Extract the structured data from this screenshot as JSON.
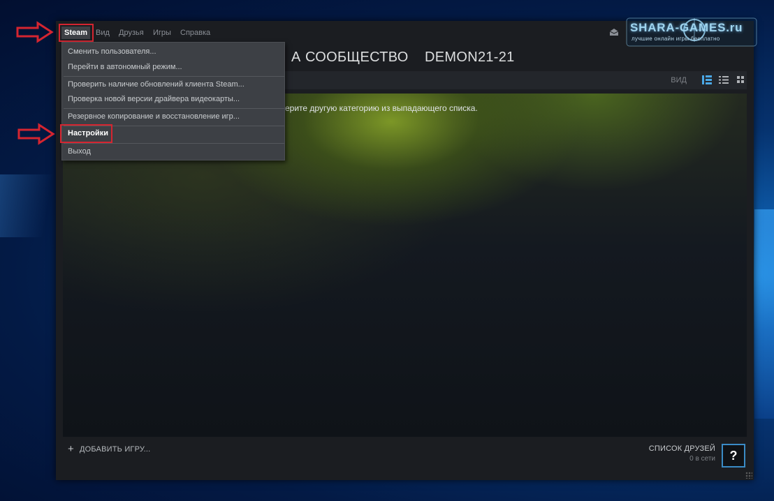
{
  "menubar": {
    "steam": "Steam",
    "view": "Вид",
    "friends": "Друзья",
    "games": "Игры",
    "help": "Справка"
  },
  "nav": {
    "partial_tab": "А",
    "community": "СООБЩЕСТВО",
    "username": "DEMON21-21"
  },
  "toolbar": {
    "view_label": "ВИД"
  },
  "dropdown": {
    "items": [
      "Сменить пользователя...",
      "Перейти в автономный режим...",
      "Проверить наличие обновлений клиента Steam...",
      "Проверка новой версии драйвера видеокарты...",
      "Резервное копирование и восстановление игр...",
      "Настройки",
      "Выход"
    ]
  },
  "content": {
    "message": "ерите другую категорию из выпадающего списка."
  },
  "bottom": {
    "add_game": "ДОБАВИТЬ ИГРУ...",
    "add_icon": "+",
    "friends_title": "СПИСОК ДРУЗЕЙ",
    "friends_online": "0 в сети",
    "help_button": "?"
  },
  "watermark": {
    "title": "SHARA-GAMES.ru",
    "subtitle": "лучшие онлайн  игры бесплатно"
  },
  "colors": {
    "accent_red": "#d52530",
    "accent_blue": "#3a8bc6",
    "window_bg": "#1b1d21",
    "menu_bg": "#3d4045"
  },
  "icons": [
    "red-arrow-icon",
    "mail-icon",
    "view-detail-icon",
    "view-list-icon",
    "view-grid-icon",
    "plus-icon",
    "help-icon",
    "resize-grip-icon"
  ]
}
